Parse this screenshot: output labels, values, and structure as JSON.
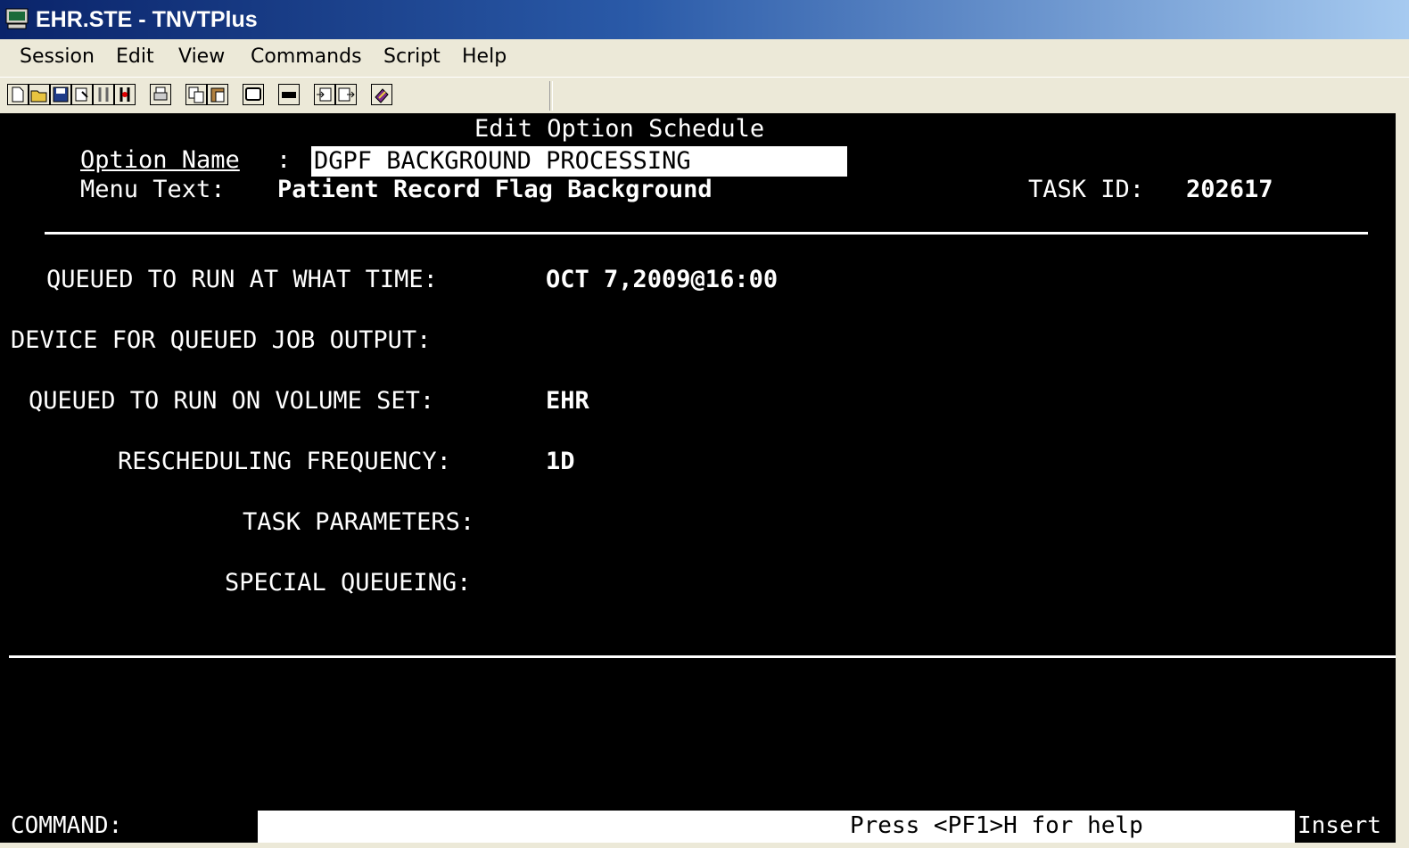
{
  "window": {
    "title": "EHR.STE - TNVTPlus"
  },
  "menu": [
    "Session",
    "Edit",
    "View",
    "Commands",
    "Script",
    "Help"
  ],
  "toolbar": [
    "new-icon",
    "open-icon",
    "save-icon",
    "properties-icon",
    "connect-icon",
    "disconnect-icon",
    "print-icon",
    "copy-icon",
    "paste-icon",
    "screen-icon",
    "keyboard-icon",
    "capture-icon",
    "playback-icon",
    "help-book-icon"
  ],
  "screen": {
    "heading": "Edit Option Schedule",
    "option_name_label": "Option Name",
    "option_name_colon": ":",
    "option_name_value": "DGPF BACKGROUND PROCESSING",
    "menu_text_label": "Menu Text:",
    "menu_text_value": "Patient Record Flag Background",
    "task_id_label": "TASK ID:",
    "task_id_value": "202617",
    "fields": {
      "queued_time_label": "QUEUED TO RUN AT WHAT TIME:",
      "queued_time_value": "OCT 7,2009@16:00",
      "device_label": "DEVICE FOR QUEUED JOB OUTPUT:",
      "volume_label": "QUEUED TO RUN ON VOLUME SET:",
      "volume_value": "EHR",
      "freq_label": "RESCHEDULING FREQUENCY:",
      "freq_value": "1D",
      "params_label": "TASK PARAMETERS:",
      "special_label": "SPECIAL QUEUEING:"
    },
    "command_label": "COMMAND:",
    "help_text": "Press <PF1>H for help",
    "insert_label": "Insert"
  }
}
